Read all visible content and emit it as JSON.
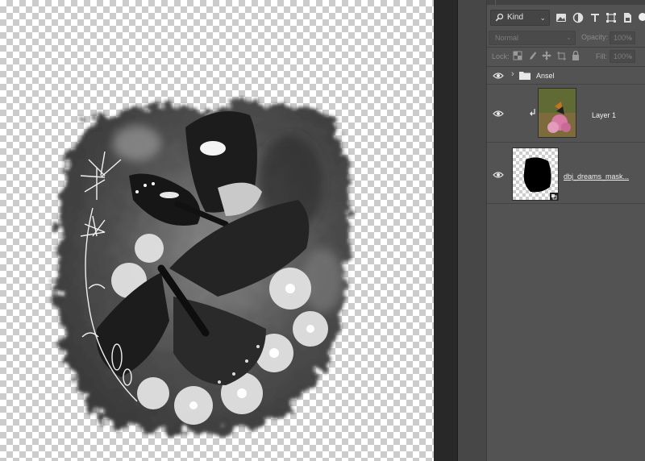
{
  "layers_panel": {
    "filter": {
      "kind_label": "Kind",
      "icons": [
        "pixel-filter-icon",
        "adjustment-filter-icon",
        "type-filter-icon",
        "shape-filter-icon",
        "smart-object-filter-icon"
      ]
    },
    "blend_mode": "Normal",
    "opacity_label": "Opacity:",
    "opacity_value": "100%",
    "lock_label": "Lock:",
    "fill_label": "Fill:",
    "fill_value": "100%",
    "layers": [
      {
        "type": "group",
        "name": "Ansel",
        "visible": true,
        "expanded": false
      },
      {
        "type": "clipped-layer",
        "name": "Layer 1",
        "visible": true,
        "clipped": true
      },
      {
        "type": "layer",
        "name": "dbj_dreams_mask...",
        "visible": true,
        "smart_object": true
      }
    ]
  },
  "canvas": {
    "background": "transparent",
    "image_content": "black-and-white butterflies on flowers with feathered mask"
  },
  "colors": {
    "panel_bg": "#535353",
    "gutter": "#282828",
    "text": "#f0f0f0",
    "dim_text": "#7c7c7c"
  }
}
